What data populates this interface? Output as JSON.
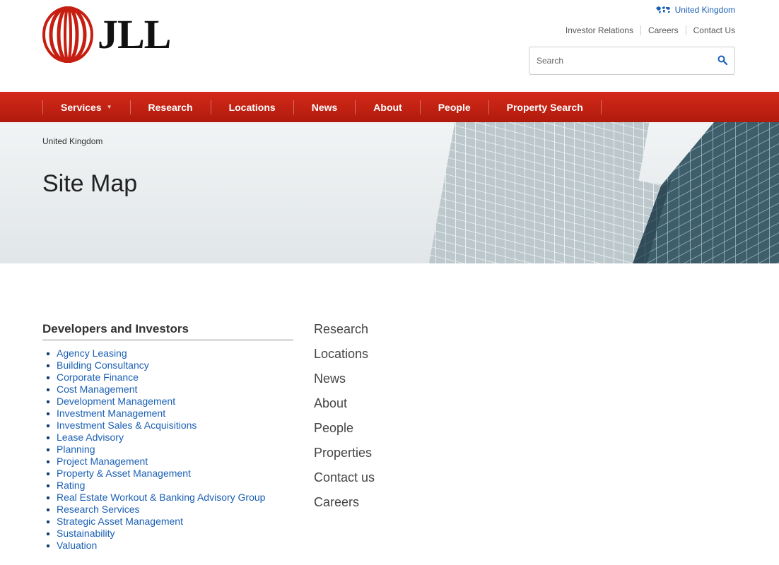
{
  "brand": {
    "name": "JLL",
    "colors": {
      "primary": "#c61e10",
      "link": "#1a5fb4"
    }
  },
  "header": {
    "country": "United Kingdom",
    "utility_links": [
      "Investor Relations",
      "Careers",
      "Contact Us"
    ],
    "search": {
      "placeholder": "Search",
      "value": ""
    }
  },
  "nav": {
    "items": [
      {
        "label": "Services",
        "has_dropdown": true
      },
      {
        "label": "Research"
      },
      {
        "label": "Locations"
      },
      {
        "label": "News"
      },
      {
        "label": "About"
      },
      {
        "label": "People"
      },
      {
        "label": "Property Search"
      }
    ]
  },
  "hero": {
    "breadcrumb": "United Kingdom",
    "title": "Site Map"
  },
  "sitemap": {
    "section_title": "Developers and Investors",
    "links": [
      "Agency Leasing",
      "Building Consultancy",
      "Corporate Finance",
      "Cost Management",
      "Development Management",
      "Investment Management",
      "Investment Sales & Acquisitions",
      "Lease Advisory",
      "Planning",
      "Project Management",
      "Property & Asset Management",
      "Rating",
      "Real Estate Workout & Banking Advisory Group",
      "Research Services",
      "Strategic Asset Management",
      "Sustainability",
      "Valuation"
    ],
    "side_links": [
      "Research",
      "Locations",
      "News",
      "About",
      "People",
      "Properties",
      "Contact us",
      "Careers"
    ]
  }
}
